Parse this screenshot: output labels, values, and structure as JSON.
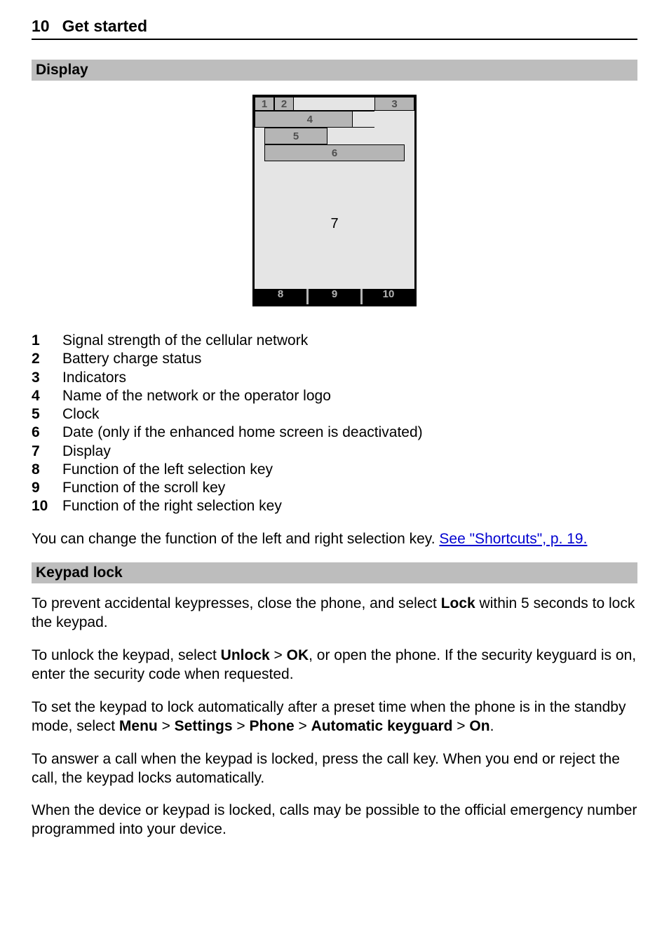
{
  "header": {
    "page_number": "10",
    "chapter": "Get started"
  },
  "sections": {
    "display": "Display",
    "keypad_lock": "Keypad lock"
  },
  "diagram": {
    "l1": "1",
    "l2": "2",
    "l3": "3",
    "l4": "4",
    "l5": "5",
    "l6": "6",
    "l7": "7",
    "l8": "8",
    "l9": "9",
    "l10": "10"
  },
  "legend": [
    {
      "n": "1",
      "t": "Signal strength of the cellular network"
    },
    {
      "n": "2",
      "t": "Battery charge status"
    },
    {
      "n": "3",
      "t": "Indicators"
    },
    {
      "n": "4",
      "t": "Name of the network or the operator logo"
    },
    {
      "n": "5",
      "t": "Clock"
    },
    {
      "n": "6",
      "t": "Date (only if the enhanced home screen is deactivated)"
    },
    {
      "n": "7",
      "t": "Display"
    },
    {
      "n": "8",
      "t": "Function of the left selection key"
    },
    {
      "n": "9",
      "t": "Function of the scroll key"
    },
    {
      "n": "10",
      "t": "Function of the right selection key"
    }
  ],
  "p_shortcuts_pre": "You can change the function of the left and right selection key. ",
  "link_shortcuts": "See \"Shortcuts\", p. 19.",
  "kl": {
    "p1a": "To prevent accidental keypresses, close the phone, and select ",
    "lock": "Lock",
    "p1b": " within 5 seconds to lock the keypad.",
    "p2a": "To unlock the keypad, select ",
    "unlock": "Unlock",
    "gt1": " > ",
    "ok": "OK",
    "p2b": ", or open the phone. If the security keyguard is on, enter the security code when requested.",
    "p3a": "To set the keypad to lock automatically after a preset time when the phone is in the standby mode, select ",
    "menu": "Menu",
    "settings": "Settings",
    "phone": "Phone",
    "autokg": "Automatic keyguard",
    "on": "On",
    "dot": ".",
    "p4": "To answer a call when the keypad is locked, press the call key. When you end or reject the call, the keypad locks automatically.",
    "p5": "When the device or keypad is locked, calls may be possible to the official emergency number programmed into your device."
  }
}
